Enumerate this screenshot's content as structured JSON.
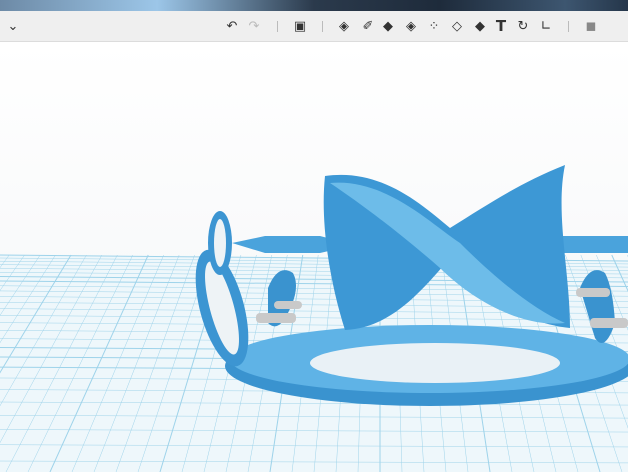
{
  "toolbar": {
    "menu_icon": "chevron-down-icon",
    "tools": [
      "undo-icon",
      "redo-icon",
      "primitives-icon",
      "sketch-icon",
      "construct-icon",
      "modify-icon",
      "pattern-icon",
      "group-icon",
      "combine-icon",
      "measure-icon",
      "text-icon",
      "snap-icon",
      "material-icon",
      "mesh-icon"
    ]
  },
  "colors": {
    "model": "#3f9bd6",
    "grid": "#9ed3ea",
    "toolbar": "#efefef"
  }
}
